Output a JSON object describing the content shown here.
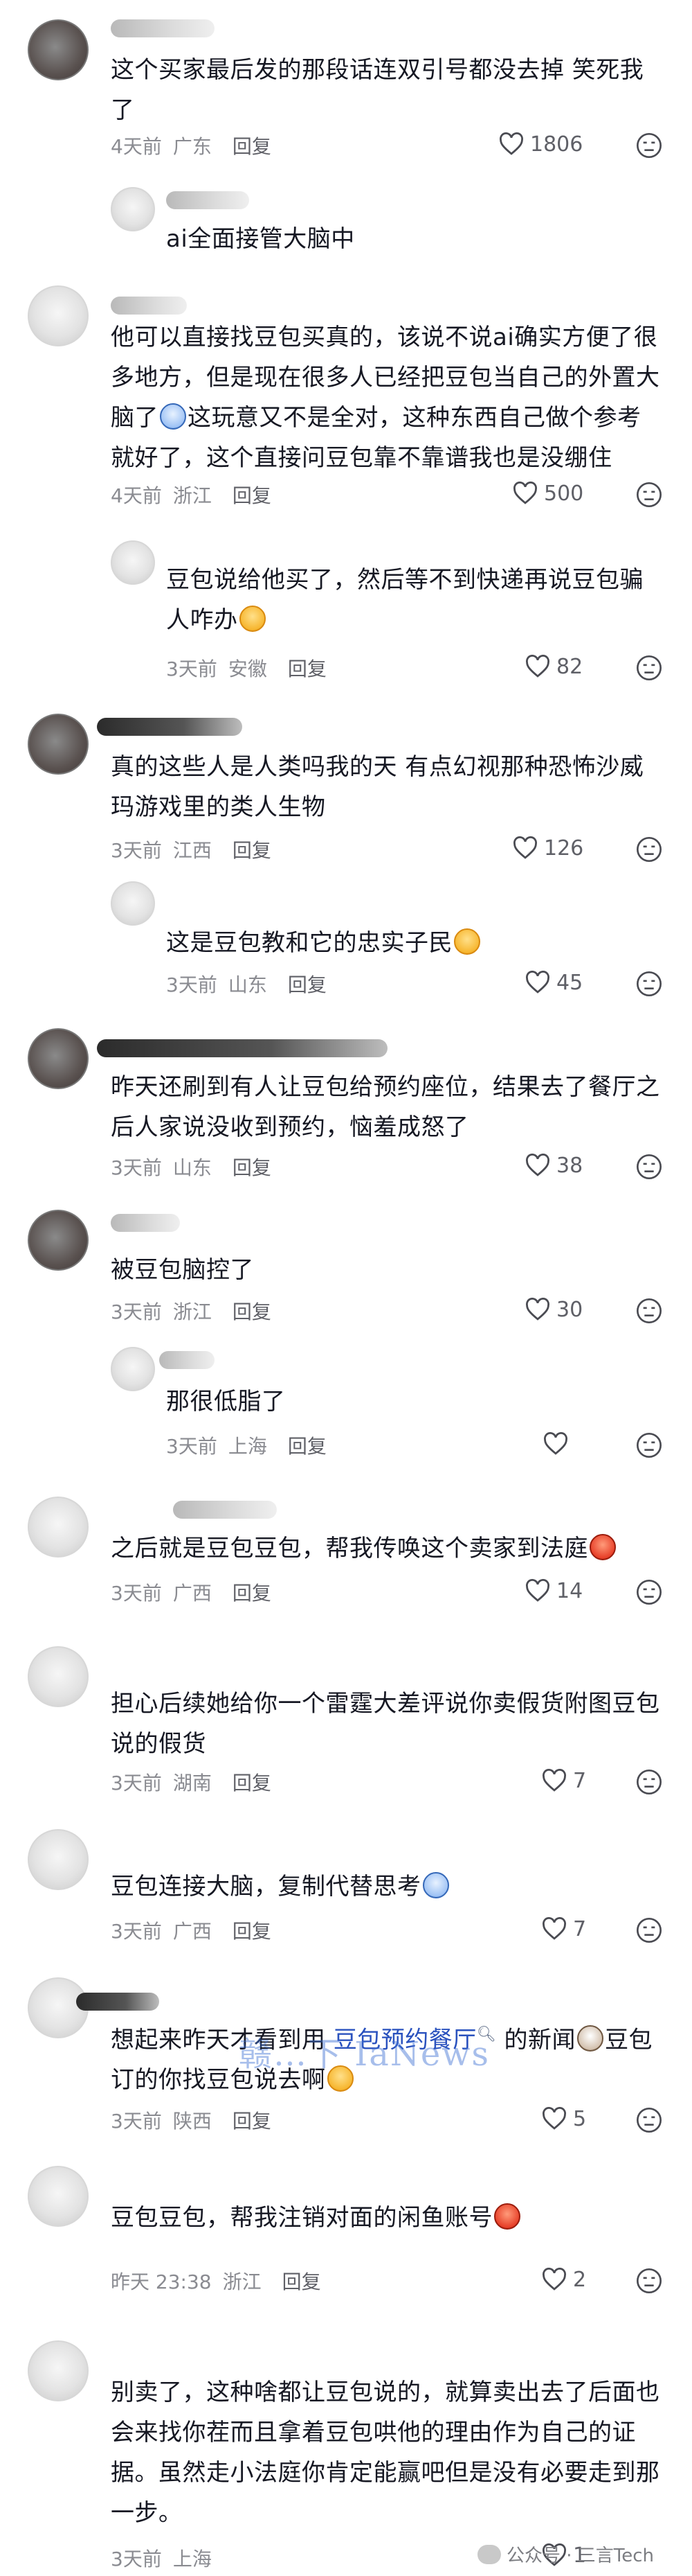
{
  "comments": [
    {
      "text": "这个买家最后发的那段话连双引号都没去掉 笑死我\n了",
      "days": "4天前",
      "location": "广东",
      "reply": "回复",
      "likes": "1806"
    },
    {
      "text": "ai全面接管大脑中"
    },
    {
      "text": "他可以直接找豆包买真的，该说不说ai确实方便了很\n多地方，但是现在很多人已经把豆包当自己的外置大\n脑了",
      "text_b": "这玩意又不是全对，这种东西自己做个参考\n就好了，这个直接问豆包靠不靠谱我也是没绷住",
      "days": "4天前",
      "location": "浙江",
      "reply": "回复",
      "likes": "500"
    },
    {
      "text": "豆包说给他买了，然后等不到快递再说豆包骗\n人咋办",
      "days": "3天前",
      "location": "安徽",
      "reply": "回复",
      "likes": "82"
    },
    {
      "text": "真的这些人是人类吗我的天 有点幻视那种恐怖沙威\n玛游戏里的类人生物",
      "days": "3天前",
      "location": "江西",
      "reply": "回复",
      "likes": "126"
    },
    {
      "text": "这是豆包教和它的忠实子民",
      "days": "3天前",
      "location": "山东",
      "reply": "回复",
      "likes": "45"
    },
    {
      "text": "昨天还刷到有人让豆包给预约座位，结果去了餐厅之\n后人家说没收到预约，恼羞成怒了",
      "days": "3天前",
      "location": "山东",
      "reply": "回复",
      "likes": "38"
    },
    {
      "text": "被豆包脑控了",
      "days": "3天前",
      "location": "浙江",
      "reply": "回复",
      "likes": "30"
    },
    {
      "text": "那很低脂了",
      "days": "3天前",
      "location": "上海",
      "reply": "回复"
    },
    {
      "text": "之后就是豆包豆包，帮我传唤这个卖家到法庭",
      "days": "3天前",
      "location": "广西",
      "reply": "回复",
      "likes": "14"
    },
    {
      "text": "担心后续她给你一个雷霆大差评说你卖假货附图豆包\n说的假货",
      "days": "3天前",
      "location": "湖南",
      "reply": "回复",
      "likes": "7"
    },
    {
      "text": "豆包连接大脑，复制代替思考",
      "days": "3天前",
      "location": "广西",
      "reply": "回复",
      "likes": "7"
    },
    {
      "text_a": "想起来昨天才看到用 ",
      "link": "豆包预约餐厅",
      "text_b": " 的新闻",
      "text_c": "豆包\n订的你找豆包说去啊",
      "days": "3天前",
      "location": "陕西",
      "reply": "回复",
      "likes": "5"
    },
    {
      "text": "豆包豆包，帮我注销对面的闲鱼账号",
      "days": "昨天 23:38",
      "location": "浙江",
      "reply": "回复",
      "likes": "2"
    },
    {
      "text": "别卖了，这种啥都让豆包说的，就算卖出去了后面也\n会来找你茬而且拿着豆包哄他的理由作为自己的证\n据。虽然走小法庭你肯定能赢吧但是没有必要走到那\n一步。",
      "days": "3天前",
      "location": "上海",
      "reply": "回复",
      "likes": "1"
    }
  ],
  "watermark": "赣…下 IaNews",
  "footer": {
    "brand": "公众号 · 三言Tech"
  },
  "icons": {
    "like": "heart-outline-icon",
    "dislike": "dislike-face-icon",
    "search": "search-mark-icon"
  },
  "colors": {
    "text": "#161823",
    "meta": "#8a8b91",
    "link": "#2a52be"
  }
}
